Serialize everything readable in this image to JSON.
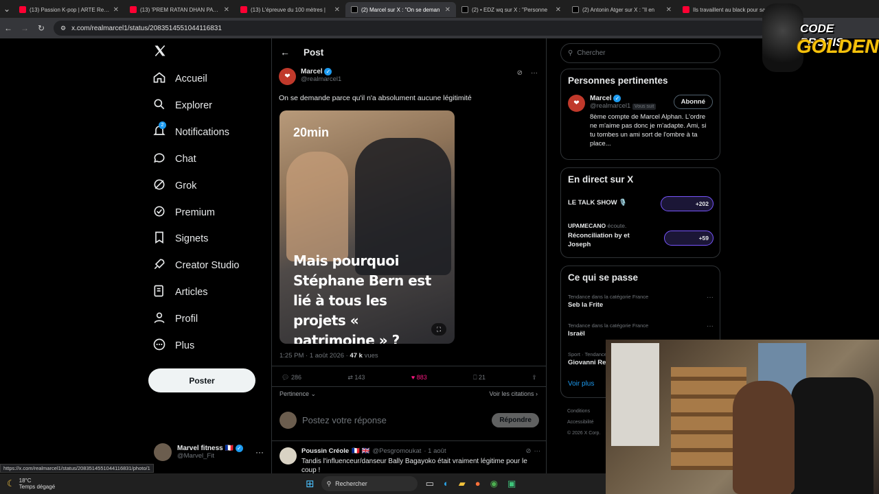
{
  "tabs": [
    {
      "title": "(13) Passion K-pop | ARTE Regar",
      "icon": "youtube",
      "color": "#ff0033",
      "active": false
    },
    {
      "title": "(13) 'PREM RATAN DHAN PAYO'",
      "icon": "youtube",
      "color": "#ff0033",
      "active": false
    },
    {
      "title": "(13) L'épreuve du 100 mètres |",
      "icon": "youtube",
      "color": "#ff0033",
      "active": false
    },
    {
      "title": "(2) Marcel sur X : \"On se deman",
      "icon": "x",
      "color": "#ffffff",
      "active": true
    },
    {
      "title": "(2) • EDZ wq sur X : \"Personne",
      "icon": "x",
      "color": "#ffffff",
      "active": false
    },
    {
      "title": "(2) Antonin Atger sur X : \"Il en",
      "icon": "x",
      "color": "#ffffff",
      "active": false
    },
    {
      "title": "Ils travaillent au black pour sau",
      "icon": "youtube",
      "color": "#ff0033",
      "active": false
    }
  ],
  "url": "x.com/realmarcel1/status/2083514551044116831",
  "status_url": "https://x.com/realmarcel1/status/2083514551044116831/photo/1",
  "nav": [
    {
      "label": "Accueil",
      "icon": "home-icon"
    },
    {
      "label": "Explorer",
      "icon": "search-icon"
    },
    {
      "label": "Notifications",
      "icon": "bell-icon",
      "badge": "2"
    },
    {
      "label": "Chat",
      "icon": "chat-icon"
    },
    {
      "label": "Grok",
      "icon": "grok-icon"
    },
    {
      "label": "Premium",
      "icon": "premium-icon"
    },
    {
      "label": "Signets",
      "icon": "bookmark-icon"
    },
    {
      "label": "Creator Studio",
      "icon": "rocket-icon"
    },
    {
      "label": "Articles",
      "icon": "article-icon"
    },
    {
      "label": "Profil",
      "icon": "person-icon"
    },
    {
      "label": "Plus",
      "icon": "more-circle-icon"
    }
  ],
  "post_button": "Poster",
  "account": {
    "name": "Marvel fitness",
    "flag": "🇫🇷",
    "handle": "@Marvel_Fit"
  },
  "header": {
    "title": "Post"
  },
  "tweet": {
    "name": "Marcel",
    "handle": "@realmarcel1",
    "text": "On se demande parce qu'il n'a absolument aucune légitimité",
    "media_brand": "20min",
    "media_caption": "Mais pourquoi Stéphane Bern est lié à tous les projets « patrimoine » ?",
    "time": "1:25 PM · 1 août 2026 · ",
    "views": "47 k",
    "views_label": " vues",
    "replies": "286",
    "retweets": "143",
    "likes": "883",
    "bookmarks": "21",
    "sort": "Pertinence",
    "quotes": "Voir les citations"
  },
  "reply_box": {
    "placeholder": "Postez votre réponse",
    "button": "Répondre"
  },
  "reply": {
    "name": "Poussin Créole",
    "flags": "🇫🇷 🇬🇧",
    "handle": "@Pesgromoukat",
    "date": "· 1 août",
    "text": "Tandis l'influenceur/danseur Bally Bagayoko était vraiment légitime pour le coup !"
  },
  "search": {
    "placeholder": "Chercher"
  },
  "relevant": {
    "title": "Personnes pertinentes",
    "name": "Marcel",
    "handle": "@realmarcel1",
    "follows_you": "Vous suit",
    "button": "Abonné",
    "bio": "8ème compte de Marcel Alphan. L'ordre ne m'aime pas donc je m'adapte. Ami, si tu tombes un ami sort de l'ombre à ta place..."
  },
  "live": {
    "title": "En direct sur X",
    "items": [
      {
        "title": "LE TALK SHOW 🎙️",
        "host": "",
        "listening": "",
        "count": "+202"
      },
      {
        "title": "Réconciliation by et Joseph",
        "host": "UPAMECANO",
        "listening": "écoute.",
        "count": "+59"
      }
    ]
  },
  "trends": {
    "title": "Ce qui se passe",
    "items": [
      {
        "category": "Tendance dans la catégorie France",
        "name": "Seb la Frite"
      },
      {
        "category": "Tendance dans la catégorie France",
        "name": "Israël"
      },
      {
        "category": "Sport · Tendance",
        "name": "Giovanni Re"
      }
    ],
    "more": "Voir plus"
  },
  "footer": {
    "links": "Conditions",
    "access": "Accessibilité",
    "copyright": "© 2026 X Corp."
  },
  "overlay": {
    "line1": "CODE PROZIS",
    "line2": "GOLDENG"
  },
  "taskbar": {
    "temp": "18°C",
    "weather": "Temps dégagé",
    "search": "Rechercher"
  },
  "colors": {
    "accent": "#1d9bf0",
    "like": "#f91880",
    "bg": "#000000"
  }
}
